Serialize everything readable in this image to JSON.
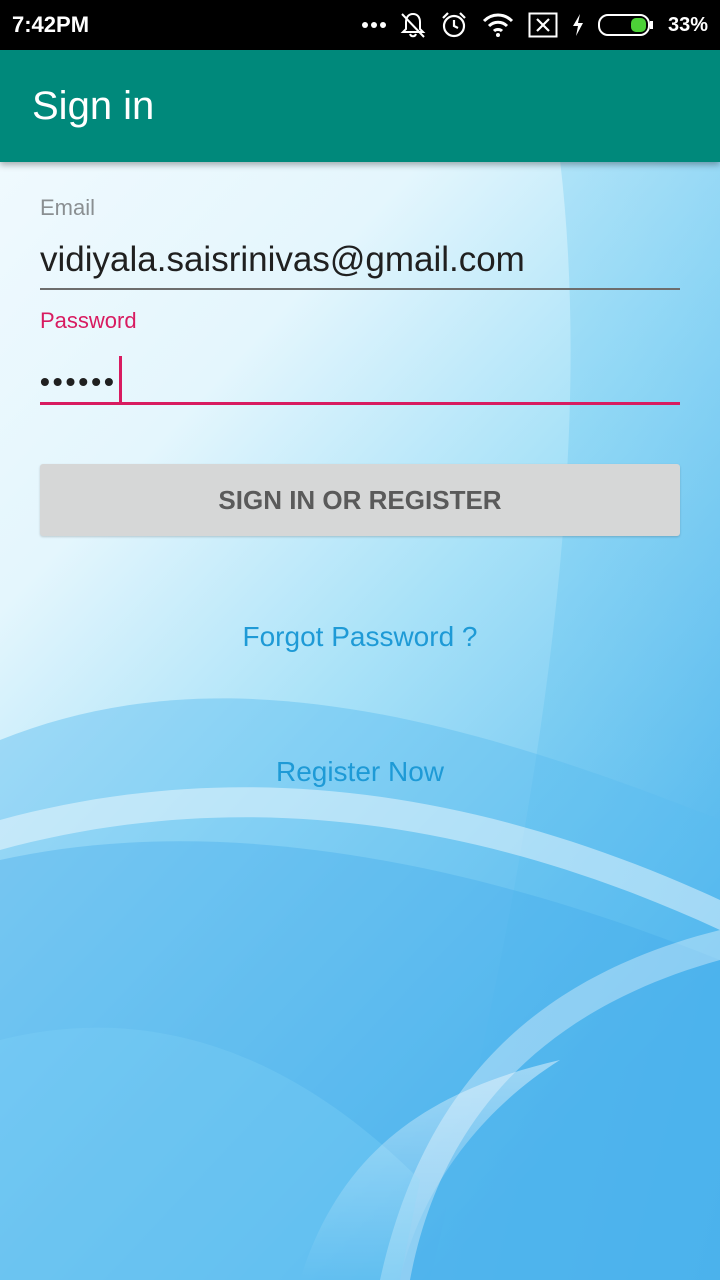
{
  "status_bar": {
    "time": "7:42PM",
    "icons": [
      "more-dots-icon",
      "notifications-off-icon",
      "alarm-icon",
      "wifi-icon",
      "sim-x-icon",
      "charging-bolt-icon",
      "battery-icon"
    ],
    "battery_percent": "33%"
  },
  "app_bar": {
    "title": "Sign in",
    "color": "#00897b"
  },
  "form": {
    "email_label": "Email",
    "email_value": "vidiyala.saisrinivas@gmail.com",
    "password_label": "Password",
    "password_value": "••••••",
    "accent_color": "#d81b60"
  },
  "actions": {
    "signin_button": "SIGN IN OR REGISTER",
    "forgot_password": "Forgot Password ?",
    "register_now": "Register Now",
    "link_color": "#1e9ad6"
  }
}
